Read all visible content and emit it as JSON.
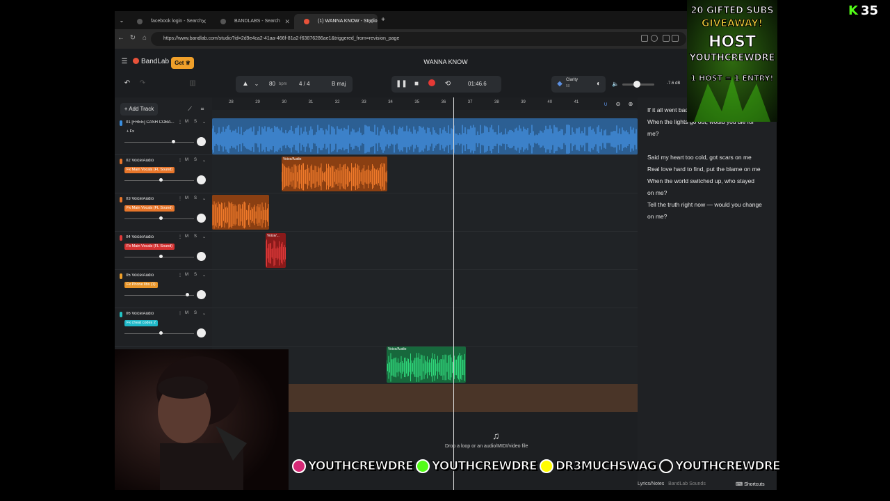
{
  "browser": {
    "tabs": [
      {
        "label": "facebook login - Search"
      },
      {
        "label": "BANDLABS - Search"
      },
      {
        "label": "(1) WANNA KNOW - Studio"
      }
    ],
    "url": "https://www.bandlab.com/studio?id=2d9e4ca2-41aa-466f-81a2-f63876286ae1&triggered_from=revision_page"
  },
  "app": {
    "logo": "BandLab",
    "get_label": "Get",
    "title": "WANNA KNOW",
    "tempo": "80",
    "tempo_unit": "bpm",
    "time_sig": "4 / 4",
    "key": "B maj",
    "time": "01:46.6",
    "clarity_label": "Clarity",
    "clarity_value": "50",
    "volume_db": "-7.6 dB",
    "add_track": "Add Track",
    "drop_message": "Drop a loop or an audio/MIDI/video file",
    "lyrics_tab": "Lyrics/Notes",
    "sounds_tab": "BandLab Sounds",
    "shortcuts": "Shortcuts"
  },
  "ruler_ticks": [
    "28",
    "29",
    "30",
    "31",
    "32",
    "33",
    "34",
    "35",
    "36",
    "37",
    "38",
    "39",
    "40",
    "41"
  ],
  "tracks": [
    {
      "name": "01 [FREE] CASH COBA...",
      "fx": "+ Fx",
      "color": "#3a8fe0",
      "fx_color": "transparent"
    },
    {
      "name": "02 Voice/Audio",
      "fx": "Fx Main Vocals (FL Sound)",
      "color": "#e8762a",
      "fx_color": "#e8762a"
    },
    {
      "name": "03 Voice/Audio",
      "fx": "Fx Main Vocals (FL Sound)",
      "color": "#e8762a",
      "fx_color": "#e8762a"
    },
    {
      "name": "04 Voice/Audio",
      "fx": "Fx Main Vocals (FL Sound)",
      "color": "#e03a3a",
      "fx_color": "#d63333"
    },
    {
      "name": "05 Voice/Audio",
      "fx": "Fx Phone libs (1)",
      "color": "#f0a02a",
      "fx_color": "#e8952a"
    },
    {
      "name": "06 Voice/Audio",
      "fx": "Fx cheat codes 2",
      "color": "#22c4c4",
      "fx_color": "#1fb8c8"
    }
  ],
  "regions": {
    "r2_label": "Voice/Audio",
    "r4_label": "Voice/...",
    "r7_label": "Voice/Audio"
  },
  "lyrics": [
    [
      "If it all went bad, would you lie for me?",
      "When the lights go out, would you die for",
      "me?"
    ],
    [
      "Said my heart too cold, got scars on me",
      "Real love hard to find, put the blame on me",
      "When the world switched up, who stayed",
      "on me?",
      "Tell the truth right now — would you change",
      "on me?"
    ]
  ],
  "overlay": {
    "kick_count": "35",
    "giveaway": [
      "20 GIFTED SUBS",
      "GIVEAWAY!",
      "HOST",
      "YOUTHCREWDRE",
      "1 HOST = 1 ENTRY!"
    ],
    "socials": [
      "YOUTHCREWDRE",
      "YOUTHCREWDRE",
      "DR3MUCHSWAG",
      "YOUTHCREWDRE"
    ]
  },
  "colors": {
    "bandlab_red": "#e8523a",
    "get_gold": "#f0a02a",
    "kick_green": "#53fc18",
    "record_red": "#e53935"
  }
}
